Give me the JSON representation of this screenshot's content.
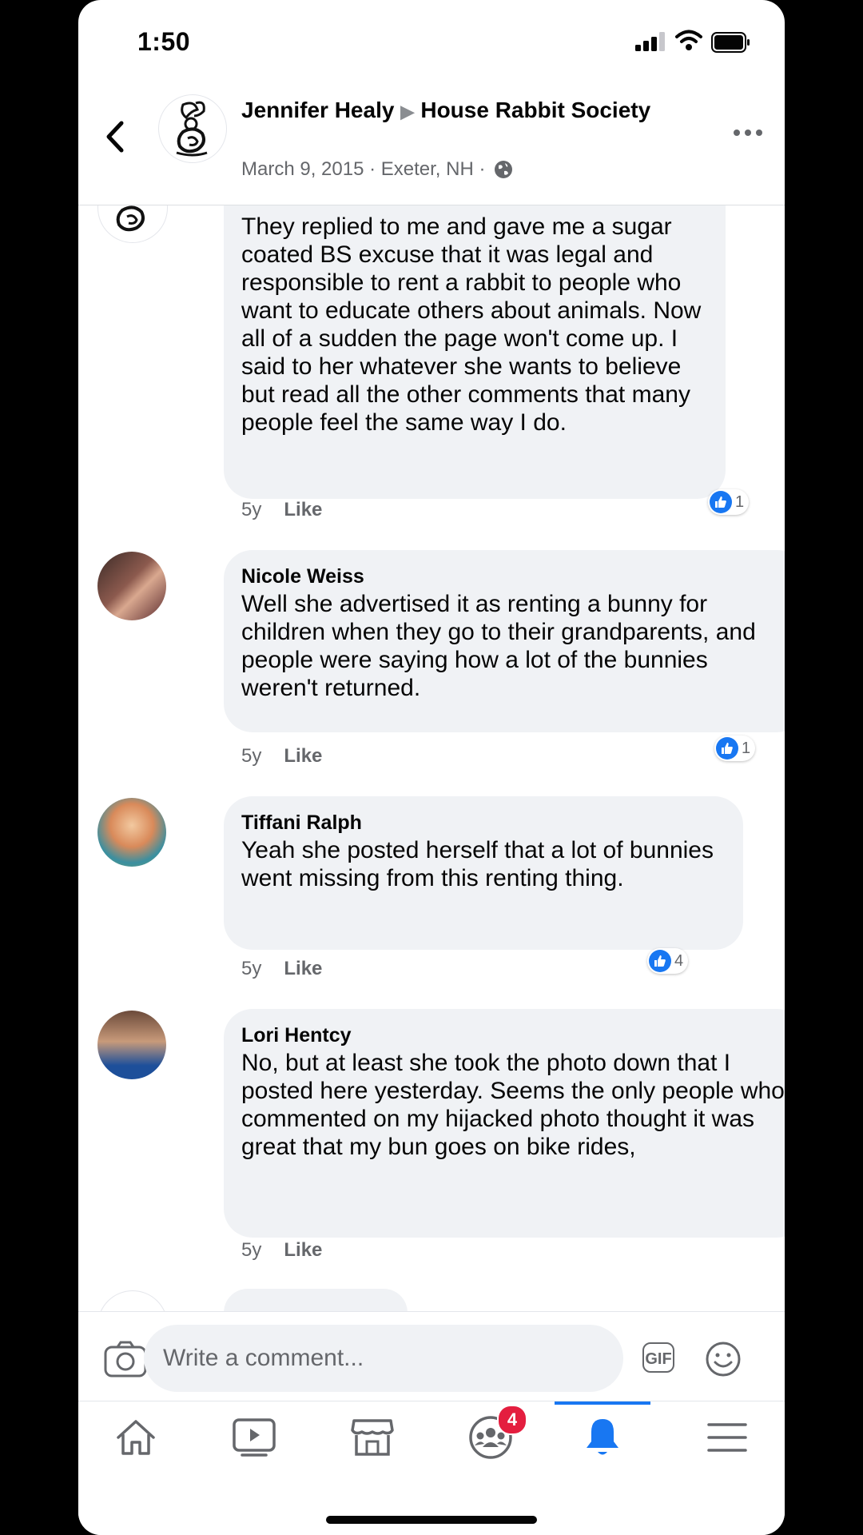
{
  "status_bar": {
    "time": "1:50"
  },
  "header": {
    "author": "Jennifer Healy",
    "group": "House Rabbit Society",
    "date": "March 9, 2015",
    "location": "Exeter, NH",
    "separator": "·"
  },
  "comments": [
    {
      "author": "",
      "text": "They replied to me and gave me a sugar coated BS excuse that it was legal and responsible to rent a rabbit to people who want to educate others about animals. Now all of a sudden the page won't come up. I said to her whatever she wants to believe but read all the other comments that many people feel the same way I do.",
      "age": "5y",
      "like_label": "Like",
      "reactions": "1"
    },
    {
      "author": "Nicole Weiss",
      "text": "Well she advertised it as renting a bunny for children when they go to their grandparents, and people were saying how a lot of the bunnies weren't returned.",
      "age": "5y",
      "like_label": "Like",
      "reactions": "1"
    },
    {
      "author": "Tiffani Ralph",
      "text": "Yeah she posted herself that a lot of bunnies went missing from this renting thing.",
      "age": "5y",
      "like_label": "Like",
      "reactions": "4"
    },
    {
      "author": "Lori Hentcy",
      "text": "No, but at least she took the photo down that I posted here yesterday. Seems the only people who commented on my hijacked photo thought it was great that my bun goes on bike rides,",
      "age": "5y",
      "like_label": "Like",
      "reactions": ""
    }
  ],
  "compose": {
    "placeholder": "Write a comment...",
    "gif_label": "GIF"
  },
  "nav": {
    "tabs": [
      "home-icon",
      "watch-icon",
      "marketplace-icon",
      "groups-icon",
      "notifications-icon",
      "menu-icon"
    ],
    "groups_badge": "4",
    "active_tab": "notifications"
  },
  "colors": {
    "accent": "#1877f2",
    "bubble": "#f0f2f5",
    "badge": "#e41e3f",
    "secondary_text": "#65676b"
  }
}
